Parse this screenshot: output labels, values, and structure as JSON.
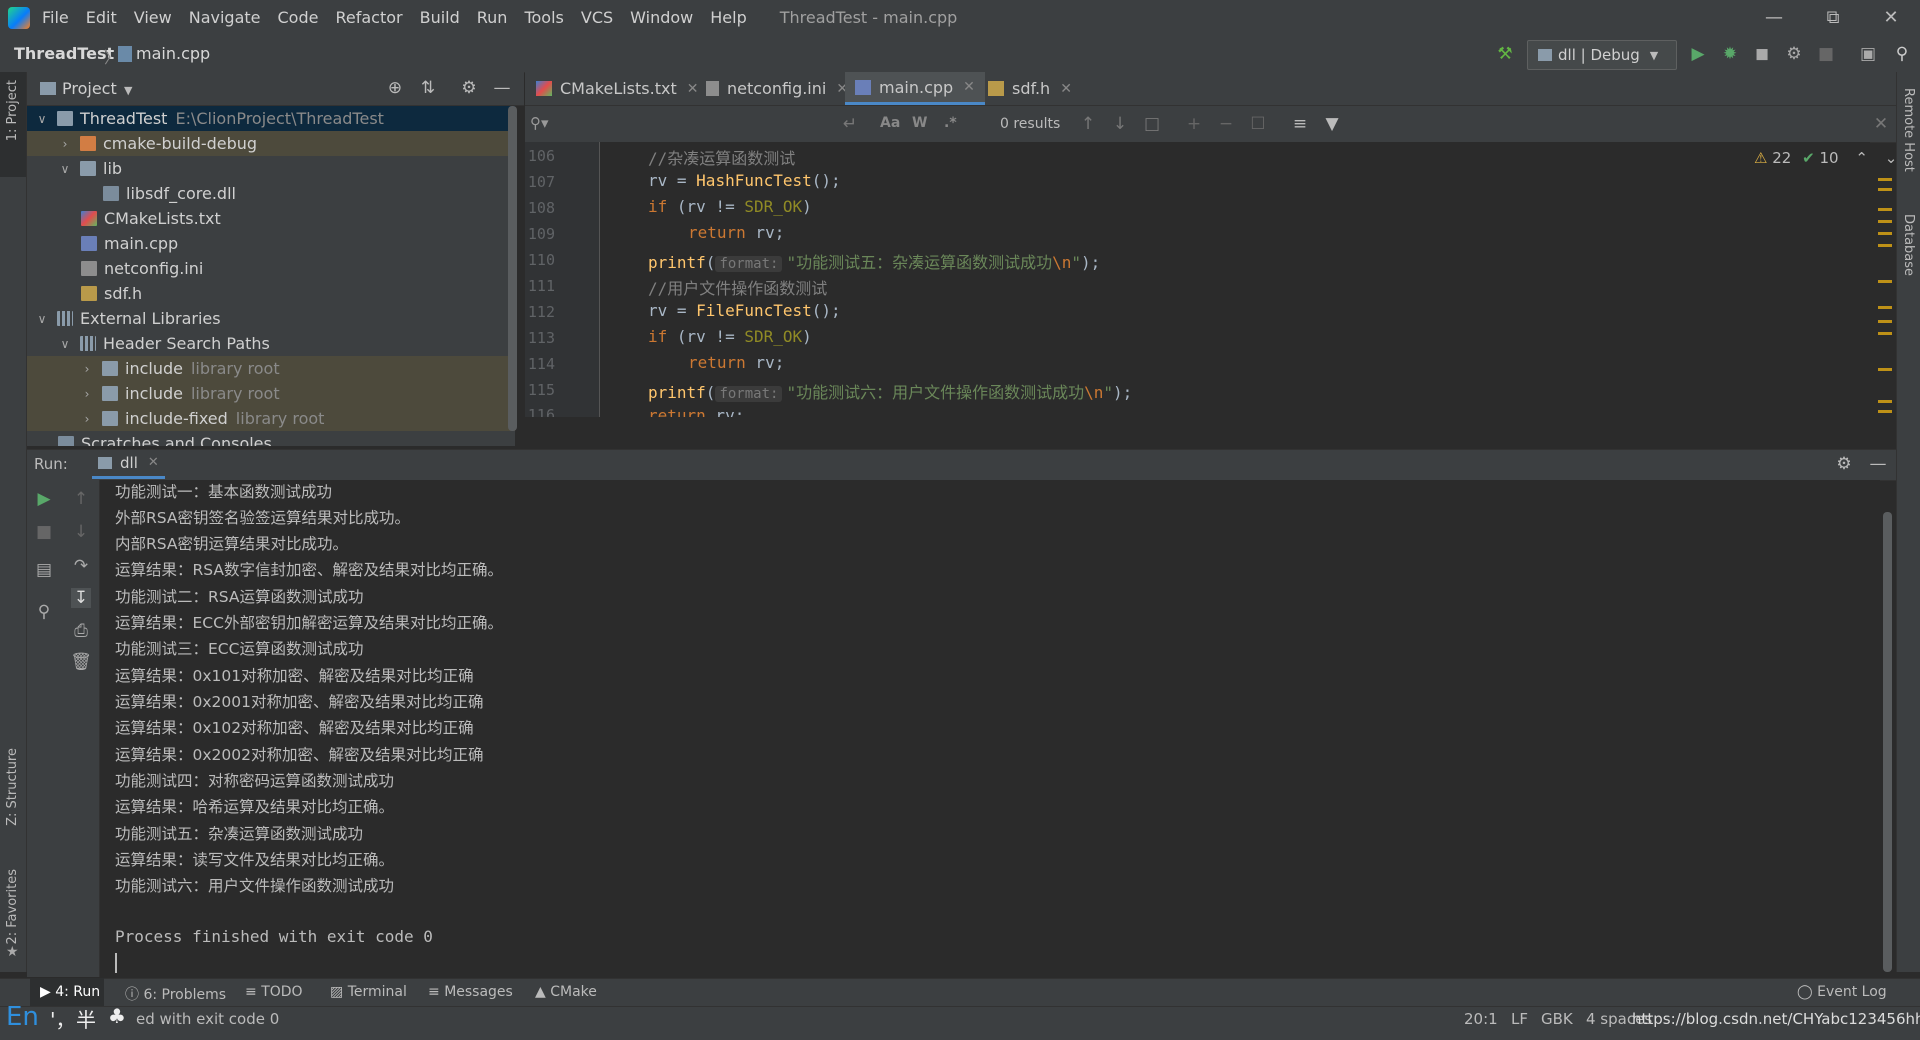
{
  "menu": {
    "items": [
      "File",
      "Edit",
      "View",
      "Navigate",
      "Code",
      "Refactor",
      "Build",
      "Run",
      "Tools",
      "VCS",
      "Window",
      "Help"
    ],
    "window_title": "ThreadTest - main.cpp"
  },
  "navbar": {
    "project": "ThreadTest",
    "separator": "〉",
    "file": "main.cpp",
    "run_config": "dll | Debug"
  },
  "project_panel": {
    "title": "Project",
    "tree": [
      {
        "label": "ThreadTest",
        "extra": "E:\\ClionProject\\ThreadTest"
      },
      {
        "label": "cmake-build-debug",
        "extra": ""
      },
      {
        "label": "lib",
        "extra": ""
      },
      {
        "label": "libsdf_core.dll",
        "extra": ""
      },
      {
        "label": "CMakeLists.txt",
        "extra": ""
      },
      {
        "label": "main.cpp",
        "extra": ""
      },
      {
        "label": "netconfig.ini",
        "extra": ""
      },
      {
        "label": "sdf.h",
        "extra": ""
      },
      {
        "label": "External Libraries",
        "extra": ""
      },
      {
        "label": "Header Search Paths",
        "extra": ""
      },
      {
        "label": "include",
        "extra": "library root"
      },
      {
        "label": "include",
        "extra": "library root"
      },
      {
        "label": "include-fixed",
        "extra": "library root"
      },
      {
        "label": "Scratches and Consoles",
        "extra": ""
      }
    ]
  },
  "tabs": [
    "CMakeLists.txt",
    "netconfig.ini",
    "main.cpp",
    "sdf.h"
  ],
  "search": {
    "results": "0 results",
    "case": "Aa",
    "word": "W",
    "regex": ".*"
  },
  "editor": {
    "warnings": "22",
    "ok": "10",
    "line_numbers": [
      "106",
      "107",
      "108",
      "109",
      "110",
      "111",
      "112",
      "113",
      "114",
      "115",
      "116"
    ],
    "lines": {
      "l106": "//杂凑运算函数测试",
      "l107_a": "rv = ",
      "l107_fn": "HashFuncTest",
      "l107_b": "();",
      "l108_kw": "if",
      "l108_a": " (rv != ",
      "l108_mac": "SDR_OK",
      "l108_b": ")",
      "l109_kw": "return",
      "l109_a": " rv;",
      "l110_fn": "printf",
      "l110_a": "(",
      "l110_hint": "format:",
      "l110_str": "\"功能测试五：杂凑运算函数测试成功",
      "l110_esc": "\\n",
      "l110_end": "\"",
      "l110_b": ");",
      "l111": "//用户文件操作函数测试",
      "l112_a": "rv = ",
      "l112_fn": "FileFuncTest",
      "l112_b": "();",
      "l113_kw": "if",
      "l113_a": " (rv != ",
      "l113_mac": "SDR_OK",
      "l113_b": ")",
      "l114_kw": "return",
      "l114_a": " rv;",
      "l115_fn": "printf",
      "l115_a": "(",
      "l115_hint": "format:",
      "l115_str": "\"功能测试六：用户文件操作函数测试成功",
      "l115_esc": "\\n",
      "l115_end": "\"",
      "l115_b": ");",
      "l116_kw": "return",
      "l116_a": " rv;"
    }
  },
  "run_panel": {
    "label": "Run:",
    "tab": "dll",
    "output": [
      "功能测试一：基本函数测试成功",
      "外部RSA密钥签名验签运算结果对比成功。",
      "内部RSA密钥运算结果对比成功。",
      "运算结果：RSA数字信封加密、解密及结果对比均正确。",
      "功能测试二：RSA运算函数测试成功",
      "运算结果：ECC外部密钥加解密运算及结果对比均正确。",
      "功能测试三：ECC运算函数测试成功",
      "运算结果：0x101对称加密、解密及结果对比均正确",
      "运算结果：0x2001对称加密、解密及结果对比均正确",
      "运算结果：0x102对称加密、解密及结果对比均正确",
      "运算结果：0x2002对称加密、解密及结果对比均正确",
      "功能测试四：对称密码运算函数测试成功",
      "运算结果：哈希运算及结果对比均正确。",
      "功能测试五：杂凑运算函数测试成功",
      "运算结果：读写文件及结果对比均正确。",
      "功能测试六：用户文件操作函数测试成功"
    ],
    "finish": "Process finished with exit code 0"
  },
  "bottom_tabs": [
    "4: Run",
    "6: Problems",
    "TODO",
    "Terminal",
    "Messages",
    "CMake"
  ],
  "event_log": "Event Log",
  "status": {
    "ime_en": "En",
    "ime_punct": "'，",
    "ime_half": "半",
    "message": "ed with exit code 0",
    "position": "20:1",
    "line_sep": "LF",
    "encoding": "GBK",
    "indent": "4 spaces",
    "watermark": "https://blog.csdn.net/CHYabc123456hh"
  },
  "left_strip": {
    "project": "1: Project",
    "structure": "Z: Structure",
    "favorites": "2: Favorites"
  },
  "right_strip": {
    "remote": "Remote Host",
    "database": "Database"
  }
}
